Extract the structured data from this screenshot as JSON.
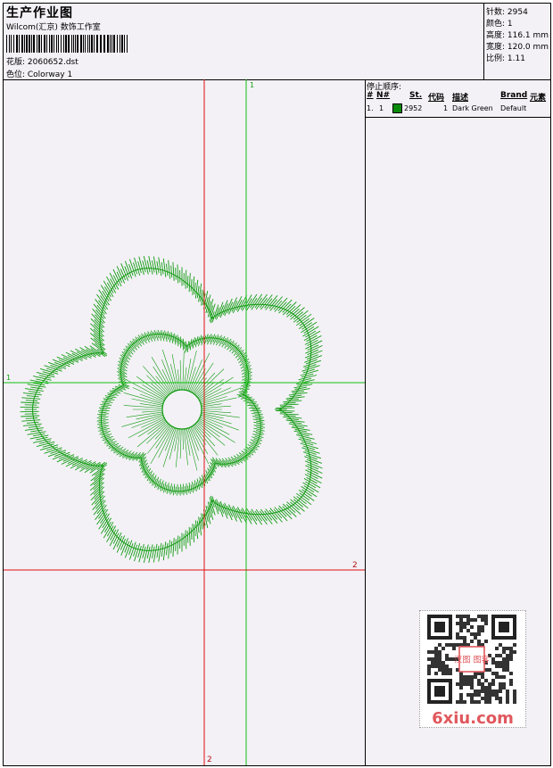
{
  "header": {
    "title": "生产作业图",
    "company": "Wilcom(汇京) 数饰工作室",
    "file_label": "花版: 2060652.dst",
    "colorway_label": "色位:  Colorway 1"
  },
  "stats": {
    "stitches": "针数: 2954",
    "colors": "颜色: 1",
    "height": "高度: 116.1 mm",
    "width": "宽度: 120.0 mm",
    "ratio": "比例: 1.11"
  },
  "design": {
    "marker_green_v": "1",
    "marker_green_h": "1",
    "marker_red_h": "2",
    "marker_red_v": "2",
    "thread_color": "#129c12",
    "crosshair_red": "#e01010",
    "crosshair_green": "#10c010"
  },
  "sequence": {
    "caption": "停止顺序:",
    "headers": [
      "#",
      "N#",
      "St.",
      "代码",
      "描述",
      "Brand",
      "元素"
    ],
    "rows": [
      {
        "num": "1.",
        "n": "1",
        "stitches": "2952",
        "code": "1",
        "desc": "Dark Green",
        "brand": "Default",
        "color": "#0a8a0a"
      }
    ]
  },
  "watermark": {
    "site": "6xiu.com",
    "qr_badge": "汉图 图客",
    "accent": "#e0585d"
  }
}
